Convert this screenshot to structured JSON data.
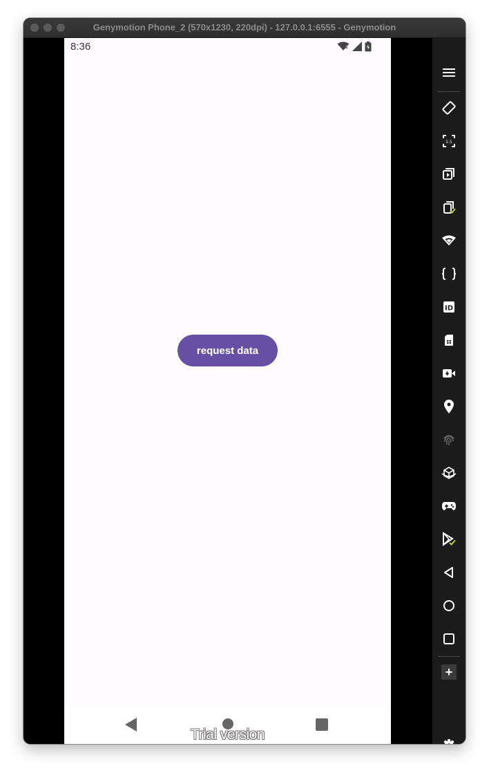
{
  "window": {
    "title": "Genymotion Phone_2 (570x1230, 220dpi) - 127.0.0.1:6555 - Genymotion"
  },
  "status_bar": {
    "time": "8:36"
  },
  "app": {
    "request_button_label": "request data"
  },
  "watermark": {
    "text": "Trial version"
  },
  "sidebar": {
    "tools": [
      "menu-icon",
      "rotate-icon",
      "pixel-perfect-icon",
      "capture-icon",
      "clipboard-icon",
      "wifi-icon",
      "code-icon",
      "device-id-icon",
      "sim-card-icon",
      "camera-icon",
      "location-pin-icon",
      "fingerprint-icon",
      "motion-sensor-icon",
      "gamepad-icon",
      "play-store-icon",
      "back-icon",
      "home-icon",
      "recents-icon",
      "add-widget-icon",
      "settings-icon"
    ]
  },
  "colors": {
    "accent": "#6750a4",
    "screen_background": "#fffbfe",
    "sidebar_background": "#1c1c1c",
    "check_green": "#b5d334"
  }
}
